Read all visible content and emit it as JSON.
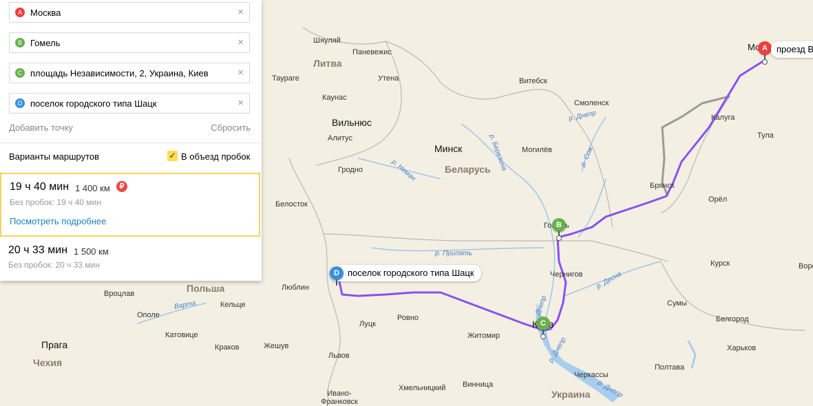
{
  "waypoints": [
    {
      "letter": "A",
      "color": "#ee3d3d",
      "value": "Москва"
    },
    {
      "letter": "B",
      "color": "#6ab04c",
      "value": "Гомель"
    },
    {
      "letter": "C",
      "color": "#6ab04c",
      "value": "площадь Независимости, 2, Украина, Киев"
    },
    {
      "letter": "D",
      "color": "#3a8fdc",
      "value": "поселок городского типа Шацк"
    }
  ],
  "clear_icon": "×",
  "add_point": "Добавить точку",
  "reset": "Сбросить",
  "variants_label": "Варианты маршрутов",
  "avoid_traffic_label": "В объезд пробок",
  "avoid_traffic_checked": true,
  "routes": [
    {
      "time": "19 ч 40 мин",
      "distance": "1 400 км",
      "no_traffic": "Без пробок: 19 ч 40 мин",
      "details": "Посмотреть подробнее",
      "toll_icon": "₽"
    },
    {
      "time": "20 ч 33 мин",
      "distance": "1 500 км",
      "no_traffic": "Без пробок: 20 ч 33 мин"
    }
  ],
  "map": {
    "countries": [
      "Литва",
      "Беларусь",
      "Польша",
      "Чехия",
      "Украина"
    ],
    "capitals": [
      "Минск",
      "Вильнюс",
      "Прага",
      "Киев"
    ],
    "cities": [
      "Шяуляй",
      "Паневежис",
      "Таураге",
      "Утена",
      "Каунас",
      "Алитус",
      "Гродно",
      "Белосток",
      "Витебск",
      "Смоленск",
      "Могилёв",
      "Гомель",
      "Калуга",
      "Тула",
      "Брянск",
      "Орёл",
      "Курск",
      "Воро",
      "Чернигов",
      "Сумы",
      "Белгород",
      "Харьков",
      "Полтава",
      "Черкассы",
      "Житомир",
      "Ровно",
      "Луцк",
      "Люблин",
      "Кельце",
      "Вроцлав",
      "Ополе",
      "Катовице",
      "Краков",
      "Жешув",
      "Львов",
      "Хмельницкий",
      "Винница",
      "Ивано-Франковск",
      "Москва"
    ],
    "rivers": [
      "р. Днепр",
      "р. Березина",
      "р. Неман",
      "р. Сож",
      "р. Припять",
      "р. Десна",
      "р. Днепр",
      "Днепр",
      "р. Днепр",
      "Варта"
    ],
    "moscow_label_partial": "Мо",
    "pin_bubbles": {
      "A": "проезд В",
      "D": "поселок городского типа Шацк"
    },
    "pins": {
      "A": "A",
      "B": "B",
      "C": "C",
      "D": "D"
    },
    "city_near_kiev_partial": "Киев",
    "colors": {
      "route": "#8c4ff0",
      "alt_route": "#9a9a9a",
      "border": "#a8a8a8",
      "river": "#8fbfea",
      "land": "#f3efe3"
    }
  }
}
